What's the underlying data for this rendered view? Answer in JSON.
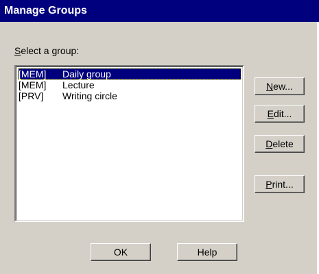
{
  "window": {
    "title": "Manage Groups"
  },
  "group_label": {
    "accel": "S",
    "rest": "elect a group:"
  },
  "groups": [
    {
      "tag": "[MEM]",
      "name": "Daily group",
      "selected": true
    },
    {
      "tag": "[MEM]",
      "name": "Lecture",
      "selected": false
    },
    {
      "tag": "[PRV]",
      "name": "Writing circle",
      "selected": false
    }
  ],
  "buttons": {
    "new": {
      "accel": "N",
      "rest": "ew..."
    },
    "edit": {
      "accel": "E",
      "rest": "dit..."
    },
    "delete": {
      "accel": "D",
      "rest": "elete"
    },
    "print": {
      "accel": "P",
      "rest": "rint..."
    },
    "ok": "OK",
    "help": "Help"
  },
  "colors": {
    "titlebar": "#00007f",
    "dialog_bg": "#d4d0c8",
    "selection": "#00007f"
  }
}
